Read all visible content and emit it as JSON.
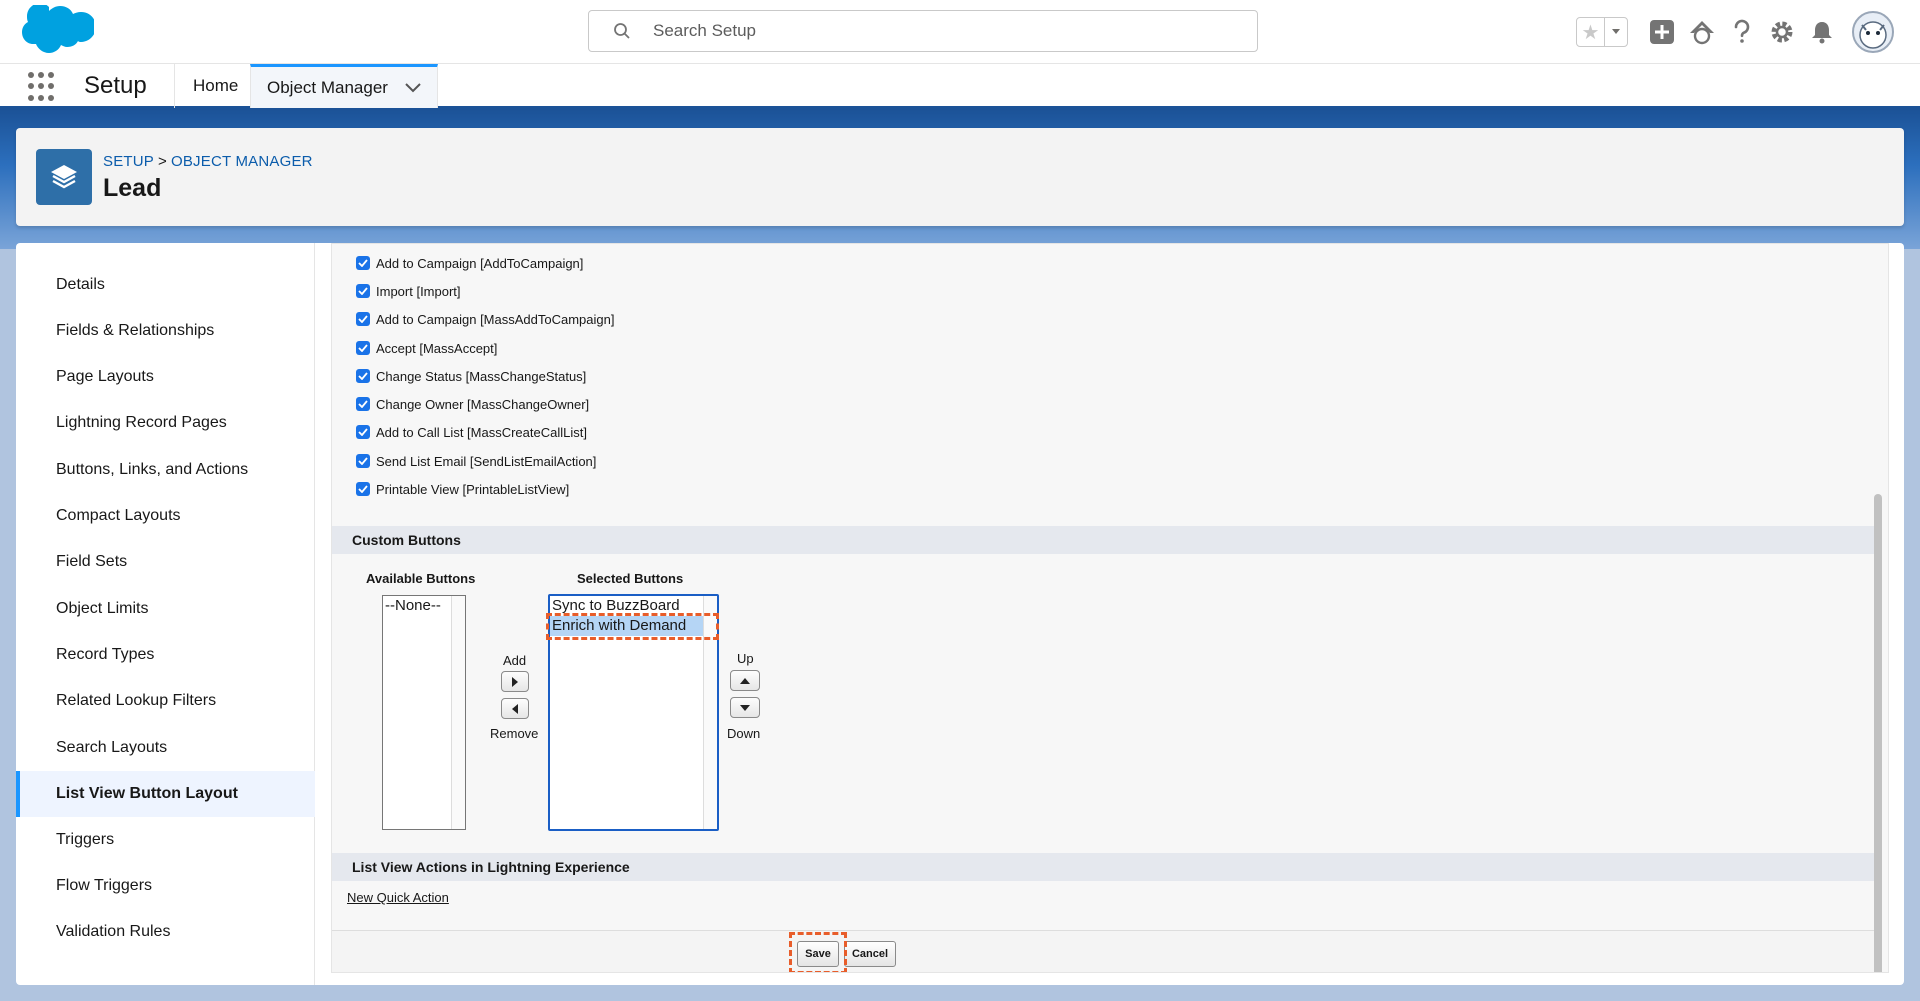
{
  "header": {
    "search_placeholder": "Search Setup"
  },
  "nav": {
    "app_name": "Setup",
    "tabs": [
      {
        "label": "Home"
      },
      {
        "label": "Object Manager"
      }
    ]
  },
  "object_header": {
    "breadcrumb_setup": "SETUP",
    "breadcrumb_sep": ">",
    "breadcrumb_object_manager": "OBJECT MANAGER",
    "title": "Lead"
  },
  "sidebar": {
    "items": [
      {
        "label": "Details"
      },
      {
        "label": "Fields & Relationships"
      },
      {
        "label": "Page Layouts"
      },
      {
        "label": "Lightning Record Pages"
      },
      {
        "label": "Buttons, Links, and Actions"
      },
      {
        "label": "Compact Layouts"
      },
      {
        "label": "Field Sets"
      },
      {
        "label": "Object Limits"
      },
      {
        "label": "Record Types"
      },
      {
        "label": "Related Lookup Filters"
      },
      {
        "label": "Search Layouts"
      },
      {
        "label": "List View Button Layout"
      },
      {
        "label": "Triggers"
      },
      {
        "label": "Flow Triggers"
      },
      {
        "label": "Validation Rules"
      }
    ],
    "active_index": 11
  },
  "standard_buttons": [
    {
      "label": "Add to Campaign [AddToCampaign]",
      "checked": true
    },
    {
      "label": "Import [Import]",
      "checked": true
    },
    {
      "label": "Add to Campaign [MassAddToCampaign]",
      "checked": true
    },
    {
      "label": "Accept [MassAccept]",
      "checked": true
    },
    {
      "label": "Change Status [MassChangeStatus]",
      "checked": true
    },
    {
      "label": "Change Owner [MassChangeOwner]",
      "checked": true
    },
    {
      "label": "Add to Call List [MassCreateCallList]",
      "checked": true
    },
    {
      "label": "Send List Email [SendListEmailAction]",
      "checked": true
    },
    {
      "label": "Printable View [PrintableListView]",
      "checked": true
    }
  ],
  "custom_buttons": {
    "section_title": "Custom Buttons",
    "available_label": "Available Buttons",
    "selected_label": "Selected Buttons",
    "available_options": [
      "--None--"
    ],
    "selected_options": [
      "Sync to BuzzBoard",
      "Enrich with Demand"
    ],
    "add_label": "Add",
    "remove_label": "Remove",
    "up_label": "Up",
    "down_label": "Down"
  },
  "list_view_actions": {
    "section_title": "List View Actions in Lightning Experience",
    "new_quick_action": "New Quick Action"
  },
  "footer": {
    "save_label": "Save",
    "cancel_label": "Cancel"
  },
  "colors": {
    "accent": "#1b96ff",
    "highlight_dash": "#e85d2a",
    "object_icon": "#2e6fa8"
  }
}
